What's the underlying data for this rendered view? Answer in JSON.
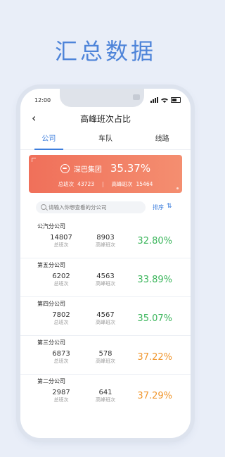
{
  "headline": "汇总数据",
  "status": {
    "time": "12:00"
  },
  "nav": {
    "back": "‹",
    "title": "高峰班次占比"
  },
  "tabs": [
    {
      "label": "公司",
      "active": true
    },
    {
      "label": "车队",
      "active": false
    },
    {
      "label": "线路",
      "active": false
    }
  ],
  "summary": {
    "group_name": "深巴集团",
    "percent": "35.37%",
    "total_label": "总班次",
    "total_value": "43723",
    "peak_label": "高峰班次",
    "peak_value": "15464",
    "separator": "|"
  },
  "search": {
    "placeholder": "请输入你想查看的分公司"
  },
  "sort": {
    "label": "排序",
    "icon": "sort-icon"
  },
  "colors": {
    "accent": "#3b7ddd",
    "green": "#3cb65c",
    "orange": "#f0962d",
    "banner": "#f0705a"
  },
  "companies": [
    {
      "name": "公汽分公司",
      "total": "14807",
      "total_label": "总班次",
      "peak": "8903",
      "peak_label": "高峰班次",
      "percent": "32.80%",
      "color": "#3cb65c"
    },
    {
      "name": "第五分公司",
      "total": "6202",
      "total_label": "总班次",
      "peak": "4563",
      "peak_label": "高峰班次",
      "percent": "33.89%",
      "color": "#3cb65c"
    },
    {
      "name": "第四分公司",
      "total": "7802",
      "total_label": "总班次",
      "peak": "4567",
      "peak_label": "高峰班次",
      "percent": "35.07%",
      "color": "#3cb65c"
    },
    {
      "name": "第三分公司",
      "total": "6873",
      "total_label": "总班次",
      "peak": "578",
      "peak_label": "高峰班次",
      "percent": "37.22%",
      "color": "#f0962d"
    },
    {
      "name": "第二分公司",
      "total": "2987",
      "total_label": "总班次",
      "peak": "641",
      "peak_label": "高峰班次",
      "percent": "37.29%",
      "color": "#f0962d"
    }
  ]
}
